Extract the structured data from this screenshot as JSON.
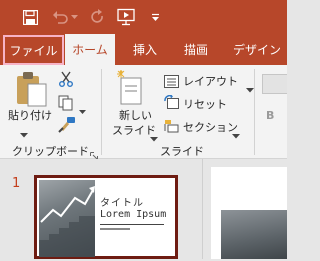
{
  "tabs": {
    "file": "ファイル",
    "home": "ホーム",
    "insert": "挿入",
    "draw": "描画",
    "design": "デザイン"
  },
  "clipboard": {
    "paste_label": "貼り付け",
    "group_label": "クリップボード"
  },
  "slides": {
    "new_slide_line1": "新しい",
    "new_slide_line2": "スライド",
    "layout_label": "レイアウト",
    "reset_label": "リセット",
    "section_label": "セクション",
    "group_label": "スライド"
  },
  "font": {
    "bold_label": "B"
  },
  "slide_panel": {
    "slide_number": "1",
    "thumb_title": "タイトル",
    "thumb_subtitle": "Lorem Ipsum"
  },
  "colors": {
    "accent": "#b7472a",
    "file_highlight": "#f7b3c7",
    "selected_thumb_border": "#6e1c12"
  }
}
